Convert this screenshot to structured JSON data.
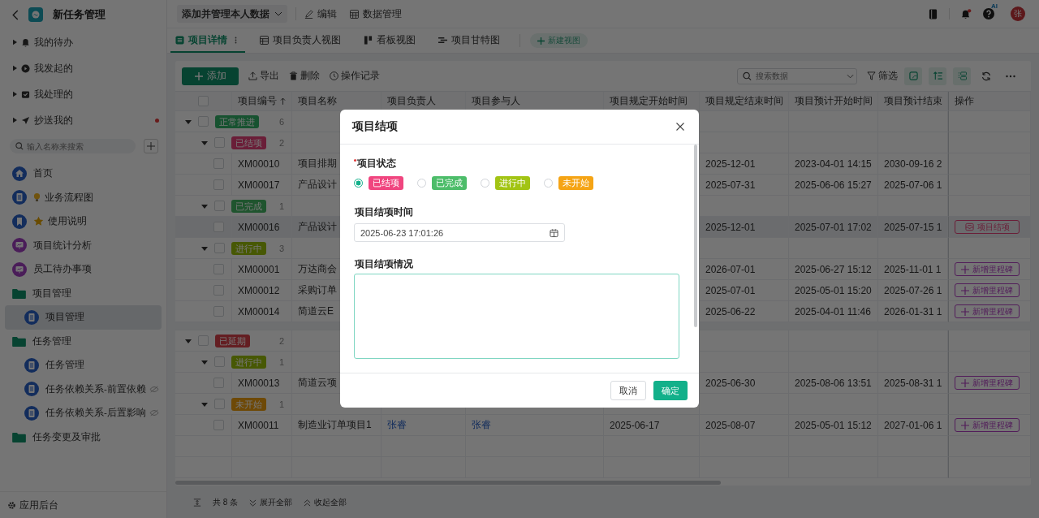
{
  "app": {
    "title": "新任务管理"
  },
  "sidebar": {
    "quick_items": [
      {
        "label": "我的待办",
        "unread": false
      },
      {
        "label": "我发起的",
        "unread": false
      },
      {
        "label": "我处理的",
        "unread": false
      },
      {
        "label": "抄送我的",
        "unread": true
      }
    ],
    "search": {
      "placeholder": "输入名称来搜索"
    },
    "nav": [
      {
        "label": "首页",
        "kind": "home",
        "selected": false
      },
      {
        "label": "业务流程图",
        "kind": "flowchart",
        "selected": false
      },
      {
        "label": "使用说明",
        "kind": "guide",
        "selected": false
      },
      {
        "label": "项目统计分析",
        "kind": "board",
        "selected": false
      },
      {
        "label": "员工待办事项",
        "kind": "board",
        "selected": false
      },
      {
        "label": "项目管理",
        "kind": "folder",
        "selected": false,
        "children": [
          {
            "label": "项目管理",
            "kind": "doc",
            "selected": true,
            "hidden": false
          }
        ]
      },
      {
        "label": "任务管理",
        "kind": "folder",
        "selected": false,
        "children": [
          {
            "label": "任务管理",
            "kind": "doc",
            "selected": false,
            "hidden": false
          },
          {
            "label": "任务依赖关系-前置依赖",
            "kind": "doc",
            "selected": false,
            "hidden": true
          },
          {
            "label": "任务依赖关系-后置影响",
            "kind": "doc",
            "selected": false,
            "hidden": true
          }
        ]
      },
      {
        "label": "任务变更及审批",
        "kind": "folder",
        "selected": false
      }
    ],
    "footer": "应用后台"
  },
  "topbar": {
    "view": "添加并管理本人数据",
    "actions": [
      {
        "label": "编辑",
        "kind": "edit"
      },
      {
        "label": "数据管理",
        "kind": "data"
      }
    ],
    "help_badge": "AI",
    "avatar": "张"
  },
  "tabs": [
    {
      "label": "项目详情",
      "kind": "list",
      "selected": true
    },
    {
      "label": "项目负责人视图",
      "kind": "table",
      "selected": false
    },
    {
      "label": "看板视图",
      "kind": "kanban",
      "selected": false
    },
    {
      "label": "项目甘特图",
      "kind": "gantt",
      "selected": false
    }
  ],
  "new_view": "新建视图",
  "toolbar": {
    "add": "添加",
    "actions": [
      {
        "label": "导出",
        "kind": "export"
      },
      {
        "label": "删除",
        "kind": "delete"
      },
      {
        "label": "操作记录",
        "kind": "history"
      }
    ],
    "search": {
      "placeholder": "搜索数据"
    },
    "filter": "筛选"
  },
  "table": {
    "columns": [
      "项目编号",
      "项目名称",
      "项目负责人",
      "项目参与人",
      "项目规定开始时间",
      "项目规定结束时间",
      "项目预计开始时间",
      "项目预计结束",
      "操作"
    ],
    "select_all": {
      "checked": false
    },
    "groups": [
      {
        "tag": "正常推进",
        "kind": "normal",
        "count": "6",
        "expanded": true,
        "checked": false,
        "children": [
          {
            "tag": "已结项",
            "kind": "closed",
            "count": "2",
            "expanded": true,
            "checked": false,
            "rows": [
              {
                "cells": [
                  "XM00010",
                  "项目排期",
                  null,
                  null,
                  null,
                  "2025-12-01",
                  "2023-04-01 14:15",
                  "2030-09-16 2"
                ],
                "selected": false,
                "checked": false
              },
              {
                "cells": [
                  "XM00017",
                  "产品设计",
                  null,
                  null,
                  null,
                  "2025-07-31",
                  "2025-06-06 15:27",
                  "2025-07-06 1"
                ],
                "selected": false,
                "checked": false
              }
            ]
          },
          {
            "tag": "已完成",
            "kind": "done",
            "count": "1",
            "expanded": true,
            "checked": false,
            "rows": [
              {
                "cells": [
                  "XM00016",
                  "产品设计",
                  null,
                  null,
                  null,
                  "2025-12-01",
                  "2025-07-01 17:02",
                  "2025-07-15 1"
                ],
                "selected": true,
                "checked": false,
                "action": {
                  "kind": "close",
                  "label": "项目结项"
                }
              }
            ]
          },
          {
            "tag": "进行中",
            "kind": "active",
            "count": "3",
            "expanded": true,
            "checked": false,
            "rows": [
              {
                "cells": [
                  "XM00001",
                  "万达商会",
                  null,
                  null,
                  null,
                  "2026-07-01",
                  "2025-06-27 15:12",
                  "2025-11-01 1"
                ],
                "selected": false,
                "checked": false,
                "action": {
                  "kind": "milestone",
                  "label": "新增里程碑"
                }
              },
              {
                "cells": [
                  "XM00012",
                  "采购订单",
                  null,
                  null,
                  null,
                  "2025-07-01",
                  "2025-05-01 15:20",
                  "2025-07-26 1"
                ],
                "selected": false,
                "checked": false,
                "action": {
                  "kind": "milestone",
                  "label": "新增里程碑"
                }
              },
              {
                "cells": [
                  "XM00014",
                  "简道云E",
                  null,
                  null,
                  null,
                  "2025-06-22",
                  "2025-04-01 11:46",
                  "2026-01-31 1"
                ],
                "selected": false,
                "checked": false,
                "action": {
                  "kind": "milestone",
                  "label": "新增里程碑"
                }
              }
            ]
          }
        ]
      },
      {
        "tag": "已延期",
        "kind": "delayed",
        "count": "2",
        "expanded": true,
        "checked": false,
        "children": [
          {
            "tag": "进行中",
            "kind": "active",
            "count": "1",
            "expanded": true,
            "checked": false,
            "rows": [
              {
                "cells": [
                  "XM00013",
                  "简道云项",
                  null,
                  null,
                  null,
                  "2025-06-30",
                  "2025-08-06 13:51",
                  "2025-08-31 1"
                ],
                "selected": false,
                "checked": false,
                "action": {
                  "kind": "milestone",
                  "label": "新增里程碑"
                }
              }
            ]
          },
          {
            "tag": "未开始",
            "kind": "pending",
            "count": "1",
            "expanded": true,
            "checked": false,
            "rows": [
              {
                "cells": [
                  "XM00011",
                  "制造业订单项目1",
                  "张睿",
                  "张睿",
                  "2025-06-17",
                  "2025-08-07",
                  "2025-05-01 15:12",
                  "2027-01-06 1"
                ],
                "selected": false,
                "checked": false,
                "action": {
                  "kind": "milestone",
                  "label": "新增里程碑"
                }
              }
            ]
          }
        ]
      }
    ]
  },
  "footer": {
    "count": "共 8 条",
    "expand_all": "展开全部",
    "collapse_all": "收起全部"
  },
  "dialog": {
    "title": "项目结项",
    "status": {
      "label": "项目状态",
      "required": true,
      "options": [
        {
          "label": "已结项",
          "color": "#f0457f",
          "selected": true
        },
        {
          "label": "已完成",
          "color": "#4dbd6a",
          "selected": false
        },
        {
          "label": "进行中",
          "color": "#a2c414",
          "selected": false
        },
        {
          "label": "未开始",
          "color": "#f5a415",
          "selected": false
        }
      ]
    },
    "close_time": {
      "label": "项目结项时间",
      "value": "2025-06-23 17:01:26"
    },
    "summary": {
      "label": "项目结项情况"
    },
    "buttons": [
      {
        "label": "取消",
        "kind": "secondary"
      },
      {
        "label": "确定",
        "kind": "primary"
      }
    ]
  }
}
